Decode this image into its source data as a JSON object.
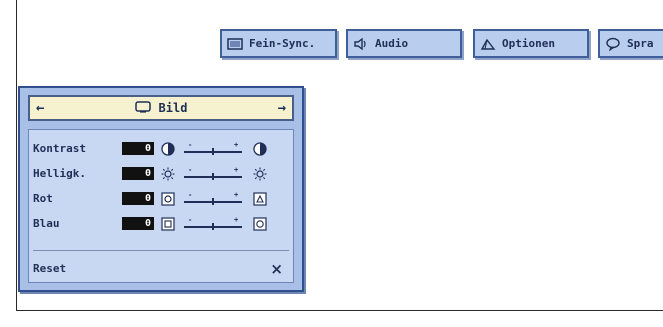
{
  "tabs": [
    {
      "label": "Fein-Sync.",
      "icon": "fine-sync-icon"
    },
    {
      "label": "Audio",
      "icon": "speaker-icon"
    },
    {
      "label": "Optionen",
      "icon": "options-icon"
    },
    {
      "label": "Spra",
      "icon": "language-bubble-icon"
    }
  ],
  "menu": {
    "title": "Bild",
    "title_icon": "monitor-icon",
    "left_arrow": "←",
    "right_arrow": "→",
    "rows": [
      {
        "label": "Kontrast",
        "value": "0",
        "icon": "contrast-icon"
      },
      {
        "label": "Helligk.",
        "value": "0",
        "icon": "brightness-icon"
      },
      {
        "label": "Rot",
        "value": "0",
        "icon": "red-icon"
      },
      {
        "label": "Blau",
        "value": "0",
        "icon": "blue-icon"
      }
    ],
    "slider_min": "-",
    "slider_max": "+",
    "reset_label": "Reset",
    "reset_icon": "×"
  },
  "colors": {
    "tab_bg": "#b9cdee",
    "menu_bg": "#a8bfe8",
    "title_bg": "#f6f2cf",
    "text": "#1f2f57"
  }
}
